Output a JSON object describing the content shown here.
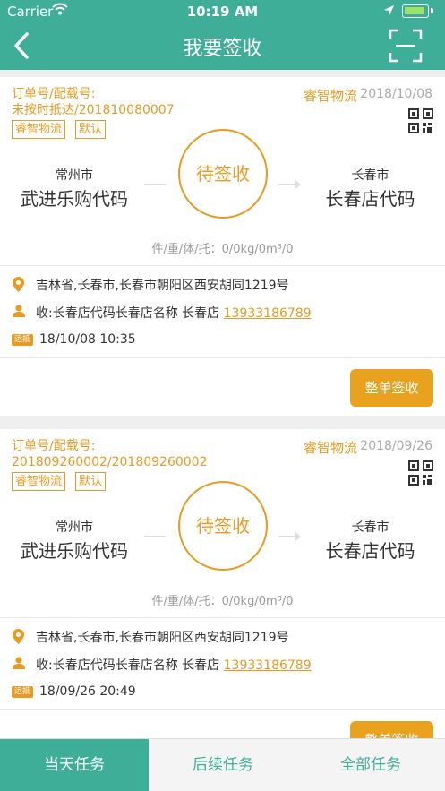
{
  "status_bar": {
    "carrier": "Carrier",
    "time": "10:19 AM"
  },
  "nav": {
    "title": "我要签收"
  },
  "colors": {
    "primary": "#3fae99",
    "accent": "#e69c24",
    "button": "#e9a11e"
  },
  "icons": {
    "back": "chevron-left-icon",
    "scan": "scan-frame-icon",
    "qr": "qr-code-icon",
    "location": "location-pin-icon",
    "person": "person-icon"
  },
  "orders": [
    {
      "order_label": "订单号/配载号:",
      "order_value": "未按时抵达/201810080007",
      "tags": [
        "睿智物流",
        "默认"
      ],
      "carrier": "睿智物流",
      "date": "2018/10/08",
      "from_city": "常州市",
      "from_name": "武进乐购代码",
      "status": "待签收",
      "to_city": "长春市",
      "to_name": "长春店代码",
      "summary": "件/重/体/托：0/0kg/0m³/0",
      "address": "吉林省,长春市,长春市朝阳区西安胡同1219号",
      "receiver": "收:长春店代码长春店名称 长春店",
      "phone": "13933186789",
      "waybill_tag": "运抵",
      "time": "18/10/08 10:35",
      "button": "整单签收"
    },
    {
      "order_label": "订单号/配载号:",
      "order_value": "201809260002/201809260002",
      "tags": [
        "睿智物流",
        "默认"
      ],
      "carrier": "睿智物流",
      "date": "2018/09/26",
      "from_city": "常州市",
      "from_name": "武进乐购代码",
      "status": "待签收",
      "to_city": "长春市",
      "to_name": "长春店代码",
      "summary": "件/重/体/托：0/0kg/0m³/0",
      "address": "吉林省,长春市,长春市朝阳区西安胡同1219号",
      "receiver": "收:长春店代码长春店名称 长春店",
      "phone": "13933186789",
      "waybill_tag": "运抵",
      "time": "18/09/26 20:49",
      "button": "整单签收"
    }
  ],
  "tabs": [
    {
      "label": "当天任务",
      "active": true
    },
    {
      "label": "后续任务",
      "active": false
    },
    {
      "label": "全部任务",
      "active": false
    }
  ]
}
